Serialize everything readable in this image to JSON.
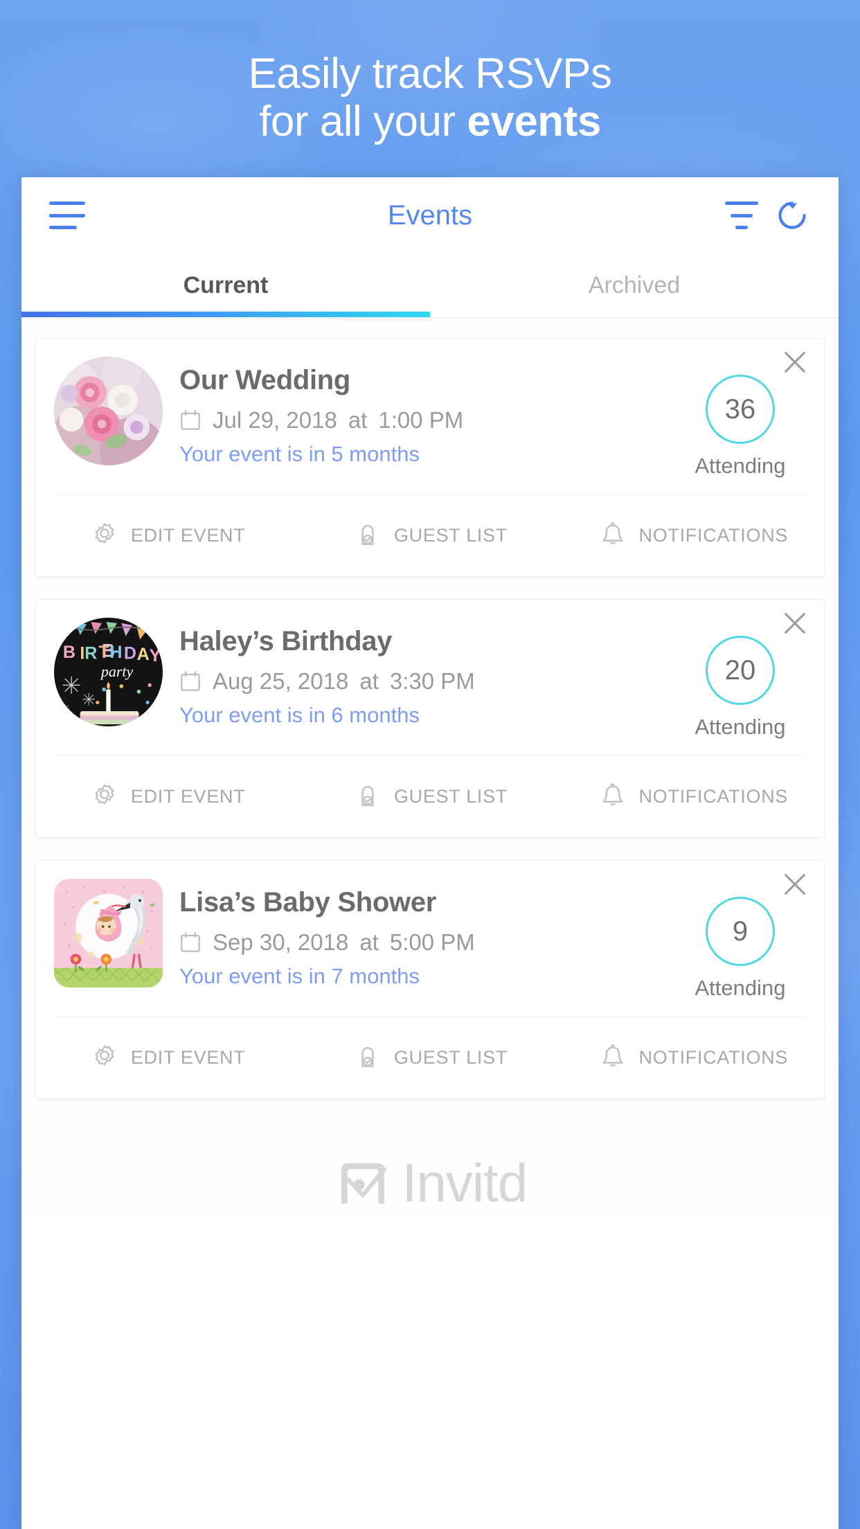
{
  "promo": {
    "line1": "Easily track RSVPs",
    "line2_prefix": "for all your ",
    "line2_bold": "events",
    "background_color": "#629cf2",
    "text_color": "#ffffff"
  },
  "app": {
    "toolbar": {
      "title": "Events",
      "menu_icon": "hamburger-menu-icon",
      "sort_icon": "sort-filter-icon",
      "refresh_icon": "refresh-icon",
      "accent_color": "#4a7ff0"
    },
    "tabs": [
      {
        "label": "Current",
        "active": true
      },
      {
        "label": "Archived",
        "active": false
      }
    ],
    "tab_underline_gradient": [
      "#4570e8",
      "#2fd8ef"
    ],
    "actions": {
      "edit": {
        "label": "EDIT EVENT",
        "icon": "gear-icon"
      },
      "guests": {
        "label": "GUEST LIST",
        "icon": "guest-check-icon"
      },
      "notifications": {
        "label": "NOTIFICATIONS",
        "icon": "bell-icon"
      }
    },
    "attending_label": "Attending",
    "attending_ring_color": "#4fd8e4",
    "close_icon": "close-x-icon",
    "calendar_icon": "calendar-icon",
    "events": [
      {
        "title": "Our Wedding",
        "date": "Jul 29, 2018",
        "at": "at",
        "time": "1:00 PM",
        "countdown": "Your event is in 5 months",
        "attending": "36",
        "thumb": "wedding-bouquet-photo"
      },
      {
        "title": "Haley’s Birthday",
        "date": "Aug 25, 2018",
        "at": "at",
        "time": "3:30 PM",
        "countdown": "Your event is in 6 months",
        "attending": "20",
        "thumb": "birthday-party-photo"
      },
      {
        "title": "Lisa’s Baby Shower",
        "date": "Sep 30, 2018",
        "at": "at",
        "time": "5:00 PM",
        "countdown": "Your event is in 7 months",
        "attending": "9",
        "thumb": "baby-shower-stork-photo"
      }
    ],
    "footer": {
      "brand": "Invitd",
      "logo_icon": "invitd-envelope-check-logo"
    }
  }
}
